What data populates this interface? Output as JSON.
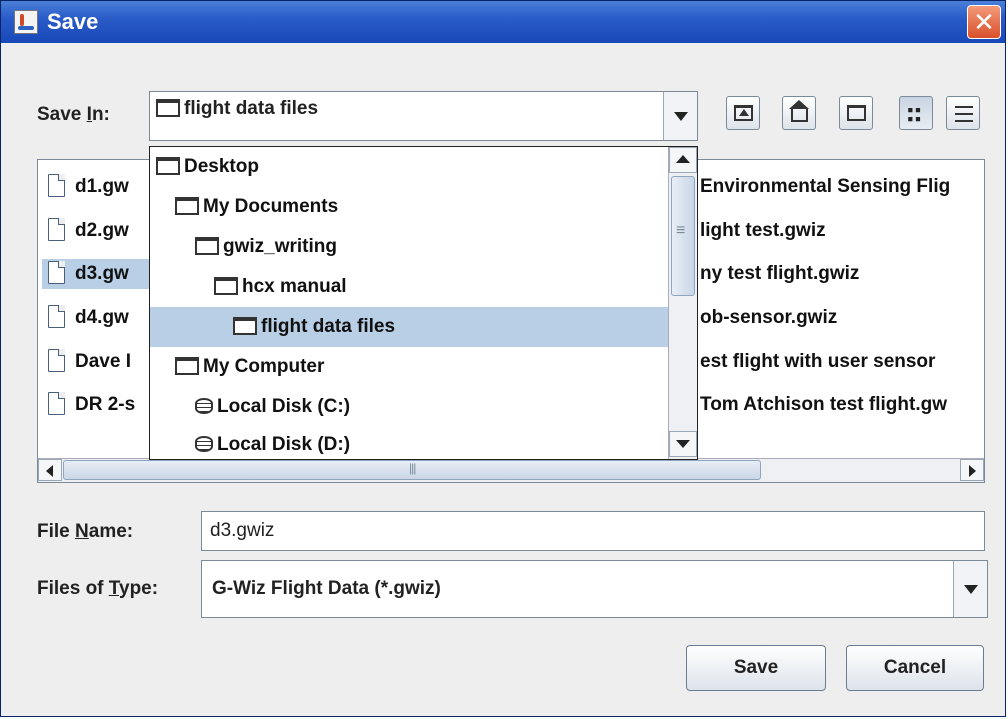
{
  "window": {
    "title": "Save",
    "close_glyph": "✕"
  },
  "save_in": {
    "label_pre": "Save ",
    "label_mnemonic": "I",
    "label_post": "n:",
    "selected": "flight data files"
  },
  "toolbar": {
    "buttons": [
      {
        "name": "up-one-level-button",
        "icon": "up-folder-icon"
      },
      {
        "name": "home-button",
        "icon": "home-icon"
      },
      {
        "name": "new-folder-button",
        "icon": "new-folder-icon"
      },
      {
        "name": "list-view-button",
        "icon": "list-view-icon"
      },
      {
        "name": "details-view-button",
        "icon": "details-view-icon"
      }
    ]
  },
  "dropdown_items": [
    {
      "label": "Desktop",
      "icon": "folder-icon"
    },
    {
      "label": "My Documents",
      "icon": "folder-icon"
    },
    {
      "label": "gwiz_writing",
      "icon": "folder-icon"
    },
    {
      "label": "hcx manual",
      "icon": "folder-icon"
    },
    {
      "label": "flight data files",
      "icon": "folder-icon"
    },
    {
      "label": "My Computer",
      "icon": "folder-icon"
    },
    {
      "label": "Local Disk (C:)",
      "icon": "disk-icon"
    },
    {
      "label": "Local Disk (D:)",
      "icon": "disk-icon"
    }
  ],
  "files_left": [
    "d1.gw",
    "d2.gw",
    "d3.gw",
    "d4.gw",
    "Dave I",
    "DR 2-s"
  ],
  "files_right": [
    "Environmental Sensing Flig",
    "light test.gwiz",
    "ny test flight.gwiz",
    "ob-sensor.gwiz",
    "est flight with user sensor",
    "Tom Atchison test flight.gw"
  ],
  "file_name": {
    "label_pre": "File ",
    "label_mnemonic": "N",
    "label_post": "ame:",
    "value": "d3.gwiz"
  },
  "file_type": {
    "label_pre": "Files of ",
    "label_mnemonic": "T",
    "label_post": "ype:",
    "selected": "G-Wiz Flight Data (*.gwiz)"
  },
  "buttons": {
    "save": "Save",
    "cancel": "Cancel"
  },
  "colors": {
    "titlebar": "#2a5cc8",
    "selection": "#b8cfe5",
    "close": "#d9502a"
  }
}
